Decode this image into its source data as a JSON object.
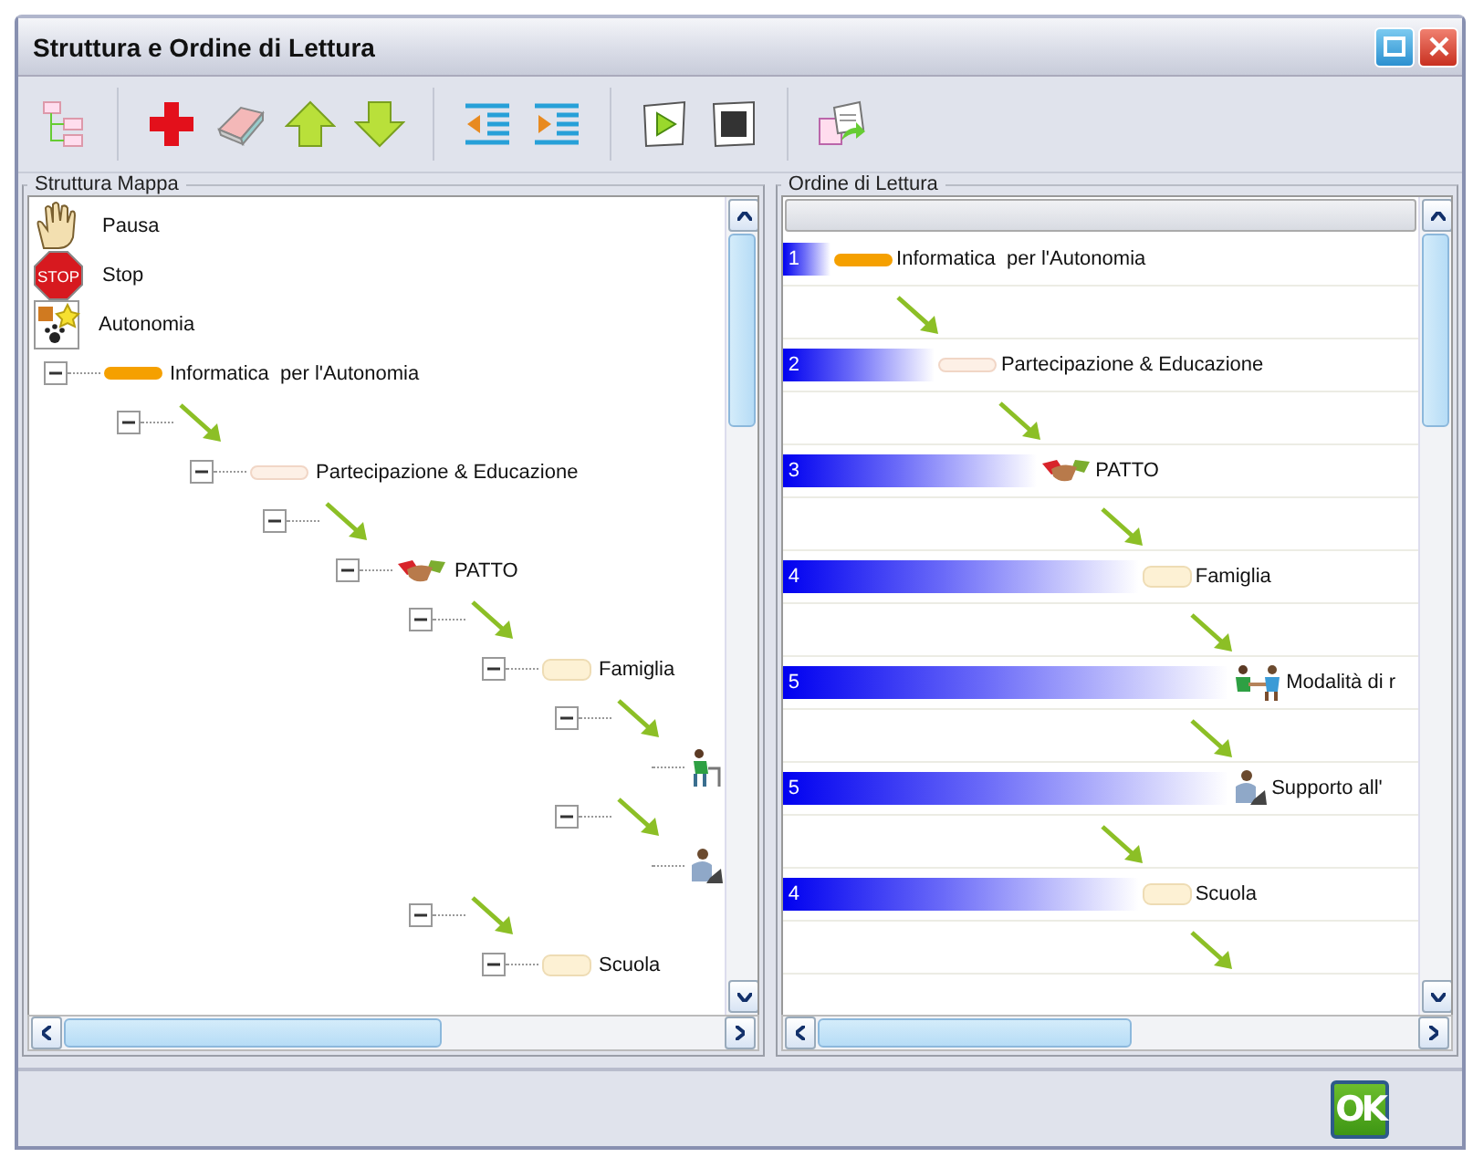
{
  "window": {
    "title": "Struttura e Ordine di Lettura"
  },
  "structure_panel": {
    "title": "Struttura Mappa",
    "legend": [
      {
        "kind": "pause",
        "label": "Pausa"
      },
      {
        "kind": "stop",
        "badge": "STOP",
        "label": "Stop"
      },
      {
        "kind": "autonomy",
        "label": "Autonomia"
      }
    ],
    "tree": [
      {
        "kind": "root",
        "label": "Informatica  per l'Autonomia",
        "expanded": true,
        "children": [
          {
            "kind": "link",
            "expanded": true,
            "children": [
              {
                "kind": "section",
                "label": "Partecipazione & Educazione",
                "expanded": true,
                "children": [
                  {
                    "kind": "link",
                    "expanded": true,
                    "children": [
                      {
                        "kind": "pact",
                        "label": "PATTO",
                        "expanded": true,
                        "children": [
                          {
                            "kind": "link",
                            "expanded": true,
                            "children": [
                              {
                                "kind": "group",
                                "label": "Famiglia",
                                "expanded": true,
                                "children": [
                                  {
                                    "kind": "link",
                                    "expanded": true,
                                    "children": [
                                      {
                                        "kind": "learner"
                                      }
                                    ]
                                  },
                                  {
                                    "kind": "link",
                                    "expanded": true,
                                    "children": [
                                      {
                                        "kind": "worker"
                                      }
                                    ]
                                  }
                                ]
                              }
                            ]
                          },
                          {
                            "kind": "link",
                            "expanded": true,
                            "children": [
                              {
                                "kind": "group",
                                "label": "Scuola",
                                "expanded": true
                              }
                            ]
                          }
                        ]
                      }
                    ]
                  }
                ]
              }
            ]
          }
        ]
      }
    ]
  },
  "reading_panel": {
    "title": "Ordine di Lettura",
    "items": [
      {
        "kind": "root",
        "number": "1",
        "level": 0.075,
        "label": "Informatica  per l'Autonomia"
      },
      {
        "kind": "link"
      },
      {
        "kind": "section",
        "number": "2",
        "level": 0.24,
        "label": "Partecipazione & Educazione"
      },
      {
        "kind": "link"
      },
      {
        "kind": "pact",
        "number": "3",
        "level": 0.4,
        "label": "PATTO"
      },
      {
        "kind": "link"
      },
      {
        "kind": "group",
        "number": "4",
        "level": 0.56,
        "label": "Famiglia"
      },
      {
        "kind": "link"
      },
      {
        "kind": "meeting",
        "number": "5",
        "level": 0.7,
        "label": "Modalità di r"
      },
      {
        "kind": "link"
      },
      {
        "kind": "worker",
        "number": "5",
        "level": 0.7,
        "label": "Supporto all'"
      },
      {
        "kind": "link"
      },
      {
        "kind": "group",
        "number": "4",
        "level": 0.56,
        "label": "Scuola"
      },
      {
        "kind": "link"
      }
    ]
  },
  "ok_button": {
    "label": "OK"
  }
}
